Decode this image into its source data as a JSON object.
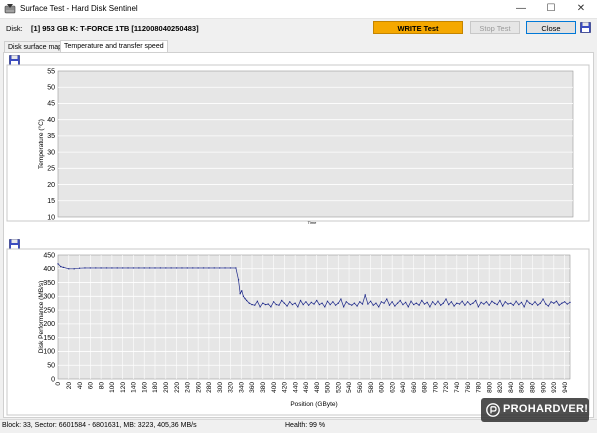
{
  "window": {
    "title": "Surface Test - Hard Disk Sentinel",
    "minimize_glyph": "—",
    "maximize_glyph": "☐",
    "close_glyph": "✕"
  },
  "disk_row": {
    "label": "Disk:",
    "value": "[1] 953 GB K: T-FORCE 1TB [112008040250483]"
  },
  "buttons": {
    "write_test": "WRITE Test",
    "stop_test": "Stop Test",
    "close": "Close"
  },
  "tabs": [
    {
      "label": "Disk surface map",
      "active": false
    },
    {
      "label": "Temperature and transfer speed",
      "active": true
    }
  ],
  "status": {
    "block_info": "Block: 33, Sector: 6601584 - 6801631, MB: 3223, 405,36 MB/s",
    "health": "Health: 99 %"
  },
  "watermark": {
    "text": "PROHARDVER!"
  },
  "colors": {
    "write_button": "#f5a800",
    "plot_background": "#e6e6e6",
    "series_line": "#1f2a8a",
    "grid": "#ffffff"
  },
  "icons": {
    "app": "hdd-app-icon",
    "save": "floppy-save-icon"
  },
  "chart_data": [
    {
      "type": "line",
      "title": "",
      "xlabel": "Time",
      "ylabel": "Temperature (°C)",
      "ylim": [
        10,
        55
      ],
      "yticks": [
        10,
        15,
        20,
        25,
        30,
        35,
        40,
        45,
        50,
        55
      ],
      "grid": true,
      "series": []
    },
    {
      "type": "line",
      "title": "",
      "xlabel": "Position (GByte)",
      "ylabel": "Disk Performance (MB/s)",
      "xlim": [
        0,
        950
      ],
      "ylim": [
        0,
        450
      ],
      "xticks": [
        0,
        20,
        40,
        60,
        80,
        100,
        120,
        140,
        160,
        180,
        200,
        220,
        240,
        260,
        280,
        300,
        320,
        340,
        360,
        380,
        400,
        420,
        440,
        460,
        480,
        500,
        520,
        540,
        560,
        580,
        600,
        620,
        640,
        660,
        680,
        700,
        720,
        740,
        760,
        780,
        800,
        820,
        840,
        860,
        880,
        900,
        920,
        940
      ],
      "yticks": [
        0,
        50,
        100,
        150,
        200,
        250,
        300,
        350,
        400,
        450
      ],
      "grid": true,
      "series": [
        {
          "x": [
            0,
            5,
            10,
            20,
            30,
            40,
            50,
            60,
            70,
            80,
            90,
            100,
            110,
            120,
            130,
            140,
            150,
            160,
            170,
            180,
            190,
            200,
            210,
            220,
            230,
            240,
            250,
            260,
            270,
            280,
            290,
            300,
            310,
            320,
            330,
            335,
            338,
            341,
            344,
            347,
            350,
            355,
            360,
            365,
            370,
            375,
            380,
            385,
            390,
            395,
            400,
            405,
            410,
            415,
            420,
            425,
            430,
            435,
            440,
            445,
            450,
            455,
            460,
            465,
            470,
            475,
            480,
            485,
            490,
            495,
            500,
            505,
            510,
            515,
            520,
            525,
            530,
            535,
            540,
            545,
            550,
            555,
            560,
            565,
            570,
            575,
            580,
            585,
            590,
            595,
            600,
            605,
            610,
            615,
            620,
            625,
            630,
            635,
            640,
            645,
            650,
            655,
            660,
            665,
            670,
            675,
            680,
            685,
            690,
            695,
            700,
            705,
            710,
            715,
            720,
            725,
            730,
            735,
            740,
            745,
            750,
            755,
            760,
            765,
            770,
            775,
            780,
            785,
            790,
            795,
            800,
            805,
            810,
            815,
            820,
            825,
            830,
            835,
            840,
            845,
            850,
            855,
            860,
            865,
            870,
            875,
            880,
            885,
            890,
            895,
            900,
            905,
            910,
            915,
            920,
            925,
            930,
            935,
            940,
            945,
            950
          ],
          "values": [
            418,
            408,
            405,
            400,
            400,
            402,
            403,
            403,
            403,
            403,
            403,
            403,
            403,
            403,
            403,
            403,
            403,
            403,
            403,
            403,
            403,
            403,
            403,
            403,
            403,
            403,
            403,
            403,
            403,
            403,
            403,
            403,
            403,
            403,
            403,
            360,
            310,
            320,
            300,
            292,
            285,
            275,
            270,
            268,
            282,
            262,
            275,
            270,
            272,
            262,
            280,
            270,
            268,
            285,
            275,
            265,
            280,
            270,
            275,
            262,
            285,
            270,
            280,
            268,
            278,
            272,
            285,
            270,
            275,
            262,
            282,
            270,
            280,
            268,
            275,
            290,
            262,
            280,
            272,
            268,
            275,
            265,
            280,
            272,
            305,
            272,
            282,
            268,
            275,
            262,
            280,
            275,
            290,
            268,
            280,
            265,
            275,
            285,
            270,
            278,
            262,
            282,
            270,
            275,
            268,
            285,
            272,
            278,
            262,
            280,
            270,
            282,
            268,
            275,
            290,
            270,
            280,
            265,
            275,
            272,
            282,
            268,
            280,
            270,
            275,
            285,
            262,
            278,
            272,
            280,
            268,
            282,
            275,
            270,
            285,
            265,
            280,
            272,
            275,
            268,
            282,
            270,
            278,
            262,
            285,
            275,
            270,
            280,
            268,
            275,
            290,
            272,
            265,
            280,
            275,
            282,
            268,
            275,
            280,
            272,
            278
          ]
        }
      ]
    }
  ]
}
